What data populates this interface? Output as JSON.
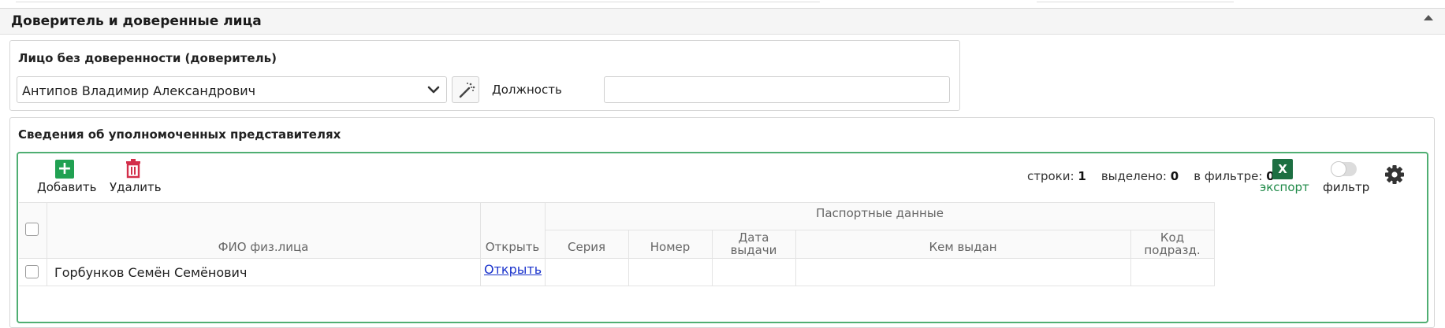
{
  "section": {
    "title": "Доверитель и доверенные лица"
  },
  "principal": {
    "title": "Лицо без доверенности (доверитель)",
    "selected": "Антипов Владимир Александрович",
    "position_label": "Должность",
    "position_value": ""
  },
  "representatives": {
    "title": "Сведения об уполномоченных представителях",
    "toolbar": {
      "add_label": "Добавить",
      "delete_label": "Удалить",
      "export_label": "экспорт",
      "excel_letter": "X",
      "filter_label": "фильтр",
      "filter_enabled": false
    },
    "counters": {
      "rows_label": "строки:",
      "rows_value": "1",
      "selected_label": "выделено:",
      "selected_value": "0",
      "filtered_label": "в фильтре:",
      "filtered_value": "0"
    },
    "table": {
      "group_header": "Паспортные данные",
      "columns": {
        "fio": "ФИО физ.лица",
        "open": "Открыть",
        "series": "Серия",
        "number": "Номер",
        "issue_date_1": "Дата",
        "issue_date_2": "выдачи",
        "issued_by": "Кем выдан",
        "dept_code_1": "Код",
        "dept_code_2": "подразд."
      },
      "rows": [
        {
          "fio": "Горбунков Семён Семёнович",
          "open_link": "Открыть",
          "series": "",
          "number": "",
          "issue_date": "",
          "issued_by": "",
          "dept_code": ""
        }
      ]
    }
  },
  "colors": {
    "accent_green": "#21a152",
    "frame_green": "#4fae72",
    "delete_red": "#d32f4a",
    "excel_green": "#1d6f42",
    "link_blue": "#1a33cc"
  }
}
